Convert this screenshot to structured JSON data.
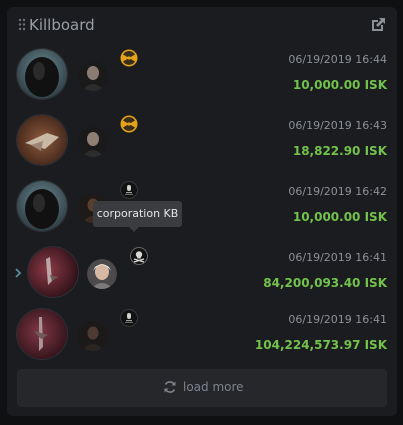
{
  "header": {
    "title": "Killboard",
    "grip_icon": "drag-handle-icon",
    "external_icon": "external-link-icon"
  },
  "entries": [
    {
      "date": "06/19/2019 16:44",
      "amount": "10,000.00 ISK",
      "corp_icon": "radiation-icon"
    },
    {
      "date": "06/19/2019 16:43",
      "amount": "18,822.90 ISK",
      "corp_icon": "radiation-icon"
    },
    {
      "date": "06/19/2019 16:42",
      "amount": "10,000.00 ISK",
      "corp_icon": "corp-logo-icon"
    },
    {
      "date": "06/19/2019 16:41",
      "amount": "84,200,093.40 ISK",
      "corp_icon": "skull-crossbones-icon",
      "expandable": true
    },
    {
      "date": "06/19/2019 16:41",
      "amount": "104,224,573.97 ISK",
      "corp_icon": "corp-logo-icon"
    }
  ],
  "tooltip": {
    "text": "corporation KB"
  },
  "load_more": {
    "label": "load more",
    "icon": "refresh-icon"
  },
  "colors": {
    "amount_green": "#73c24c",
    "panel_bg": "#1b1c1f",
    "button_bg": "#25272b"
  }
}
